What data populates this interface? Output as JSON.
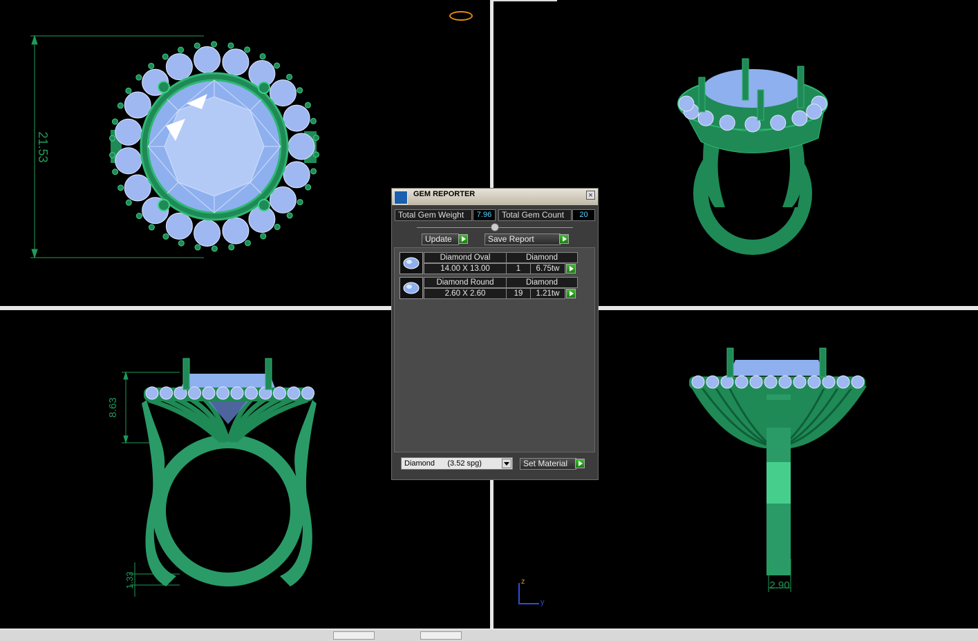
{
  "dimensions": {
    "top_height": "21.53",
    "front_height": "8.63",
    "front_shank": "1.33",
    "right_width": "2.90"
  },
  "axes": {
    "z": "z",
    "y": "y"
  },
  "gem_reporter": {
    "title": "GEM REPORTER",
    "total_weight_label": "Total Gem Weight",
    "total_weight_value": "7.96",
    "total_count_label": "Total Gem Count",
    "total_count_value": "20",
    "update_label": "Update",
    "save_report_label": "Save Report",
    "gems": [
      {
        "name": "Diamond Oval",
        "material": "Diamond",
        "size": "14.00 X 13.00",
        "count": "1",
        "weight": "6.75tw"
      },
      {
        "name": "Diamond Round",
        "material": "Diamond",
        "size": "2.60 X 2.60",
        "count": "19",
        "weight": "1.21tw"
      }
    ],
    "material_select": "Diamond      (3.52 spg)",
    "set_material_label": "Set Material"
  },
  "colors": {
    "metal": "#1f8a56",
    "metal_light": "#2fb774",
    "gem": "#9fb8f2",
    "gem_dark": "#5878c8",
    "dimension": "#1f9b57"
  }
}
